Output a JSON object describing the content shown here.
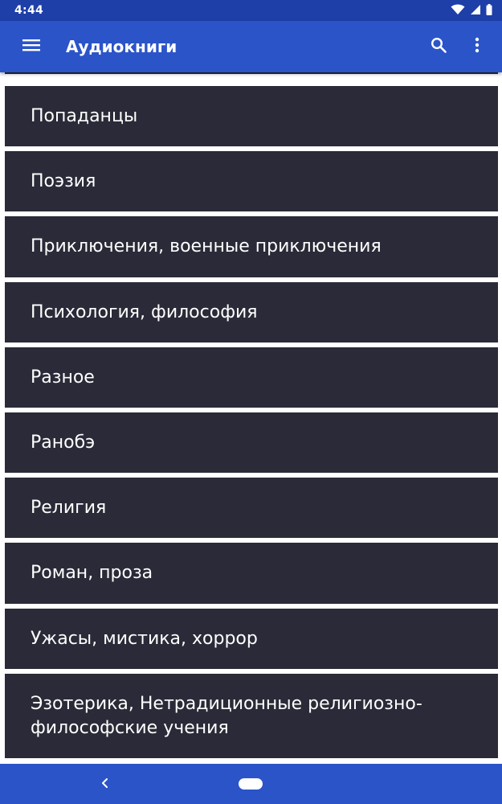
{
  "status_bar": {
    "time": "4:44",
    "icons": [
      "wifi-icon",
      "signal-icon",
      "battery-icon"
    ]
  },
  "app_bar": {
    "title": "Аудиокниги",
    "icons": [
      "menu-icon",
      "search-icon",
      "more-vert-icon"
    ]
  },
  "genres": [
    "Попаданцы",
    "Поэзия",
    "Приключения, военные приключения",
    "Психология, философия",
    "Разное",
    "Ранобэ",
    "Религия",
    "Роман, проза",
    "Ужасы, мистика, хоррор",
    "Эзотерика, Нетрадиционные религиозно-философские учения"
  ],
  "nav_bar": {
    "icons": [
      "back-icon",
      "home-pill"
    ]
  },
  "colors": {
    "status_bar": "#1e3fa8",
    "app_bar": "#2b54c8",
    "list_item": "#2a2a38",
    "text": "#ffffff"
  }
}
